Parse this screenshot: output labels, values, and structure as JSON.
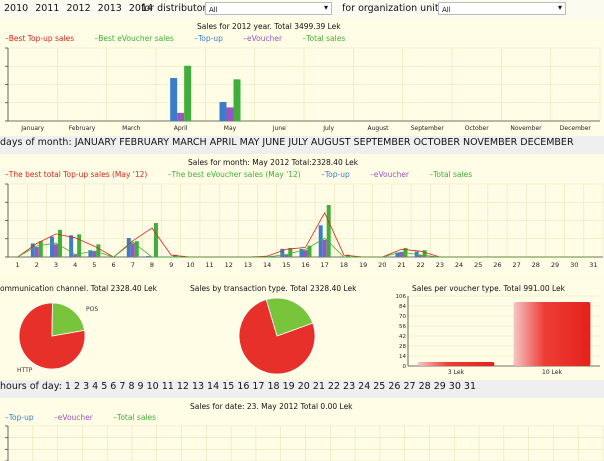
{
  "filters": {
    "years": [
      "2010",
      "2011",
      "2012",
      "2013",
      "2014"
    ],
    "distributor_label": "for distributor:",
    "distributor_value": "All",
    "org_label": "for organization unit:",
    "org_value": "All"
  },
  "year_chart": {
    "title": "Sales for 2012 year. Total 3499.39 Lek",
    "legend": [
      {
        "label": "Best Top-up sales",
        "color": "#d9261c"
      },
      {
        "label": "Best eVoucher sales",
        "color": "#3fae3a"
      },
      {
        "label": "Top-up",
        "color": "#3a7dc9"
      },
      {
        "label": "eVoucher",
        "color": "#9a55c0"
      },
      {
        "label": "Total sales",
        "color": "#3fae3a"
      }
    ]
  },
  "days_strip": {
    "prefix": "days of month:",
    "months": [
      "JANUARY",
      "FEBRUARY",
      "MARCH",
      "APRIL",
      "MAY",
      "JUNE",
      "JULY",
      "AUGUST",
      "SEPTEMBER",
      "OCTOBER",
      "NOVEMBER",
      "DECEMBER"
    ]
  },
  "month_chart": {
    "title": "Sales for month: May 2012 Total:2328.40 Lek",
    "legend": [
      {
        "label": "The best total Top-up sales (May '12)",
        "color": "#d9261c"
      },
      {
        "label": "The best eVoucher sales (May '12)",
        "color": "#3fae3a"
      },
      {
        "label": "Top-up",
        "color": "#3a7dc9"
      },
      {
        "label": "eVoucher",
        "color": "#9a55c0"
      },
      {
        "label": "Total sales",
        "color": "#3fae3a"
      }
    ]
  },
  "pie_channel": {
    "title": "ommunication channel. Total 2328.40 Lek",
    "labels": [
      "POS",
      "HTTP"
    ]
  },
  "pie_transaction": {
    "title": "Sales by transaction type. Total 2328.40 Lek"
  },
  "voucher_chart": {
    "title": "Sales per voucher type. Total 991.00 Lek"
  },
  "hours_strip": {
    "prefix": "hours of day:",
    "days": [
      "1",
      "2",
      "3",
      "4",
      "5",
      "6",
      "7",
      "8",
      "9",
      "10",
      "11",
      "12",
      "13",
      "14",
      "15",
      "16",
      "17",
      "18",
      "19",
      "20",
      "21",
      "22",
      "23",
      "24",
      "25",
      "26",
      "27",
      "28",
      "29",
      "30",
      "31"
    ]
  },
  "date_chart": {
    "title": "Sales for date: 23. May 2012 Total 0.00 Lek",
    "legend": [
      {
        "label": "Top-up",
        "color": "#3a7dc9"
      },
      {
        "label": "eVoucher",
        "color": "#9a55c0"
      },
      {
        "label": "Total sales",
        "color": "#3fae3a"
      }
    ]
  },
  "chart_data": [
    {
      "type": "bar",
      "title": "Sales for 2012 year. Total 3499.39 Lek",
      "categories": [
        "January",
        "February",
        "March",
        "April",
        "May",
        "June",
        "July",
        "August",
        "September",
        "October",
        "November",
        "December"
      ],
      "series": [
        {
          "name": "Top-up",
          "color": "#3a7dc9",
          "values": [
            0,
            0,
            0,
            0.95,
            0.42,
            0,
            0,
            0,
            0,
            0,
            0,
            0
          ]
        },
        {
          "name": "eVoucher",
          "color": "#9a55c0",
          "values": [
            0,
            0,
            0,
            0.18,
            0.3,
            0,
            0,
            0,
            0,
            0,
            0,
            0
          ]
        },
        {
          "name": "Total sales",
          "color": "#3fae3a",
          "values": [
            0,
            0,
            0.01,
            1.22,
            0.92,
            0,
            0,
            0,
            0,
            0,
            0,
            0
          ]
        }
      ]
    },
    {
      "type": "bar",
      "title": "Sales for month: May 2012 Total:2328.40 Lek",
      "categories": [
        "1",
        "2",
        "3",
        "4",
        "5",
        "6",
        "7",
        "8",
        "9",
        "10",
        "11",
        "12",
        "13",
        "14",
        "15",
        "16",
        "17",
        "18",
        "19",
        "20",
        "21",
        "22",
        "23",
        "24",
        "25",
        "26",
        "27",
        "28",
        "29",
        "30",
        "31"
      ],
      "series": [
        {
          "name": "Top-up",
          "color": "#3a7dc9",
          "values": [
            0,
            0.3,
            0.45,
            0.48,
            0.15,
            0,
            0.42,
            0.02,
            0,
            0,
            0,
            0,
            0,
            0,
            0.18,
            0.18,
            0.7,
            0,
            0,
            0,
            0.1,
            0.12,
            0,
            0,
            0,
            0,
            0,
            0,
            0,
            0,
            0
          ]
        },
        {
          "name": "eVoucher",
          "color": "#9a55c0",
          "values": [
            0,
            0.22,
            0.28,
            0.05,
            0.12,
            0,
            0.3,
            0,
            0,
            0,
            0,
            0,
            0,
            0,
            0.05,
            0.15,
            0.38,
            0,
            0,
            0,
            0.1,
            0.04,
            0,
            0,
            0,
            0,
            0,
            0,
            0,
            0,
            0
          ]
        },
        {
          "name": "Total sales",
          "color": "#3fae3a",
          "values": [
            0,
            0.35,
            0.6,
            0.5,
            0.28,
            0,
            0.35,
            0.75,
            0.05,
            0,
            0,
            0,
            0,
            0.02,
            0.2,
            0.25,
            1.15,
            0.05,
            0,
            0,
            0.2,
            0.15,
            0,
            0,
            0,
            0,
            0,
            0,
            0,
            0,
            0
          ]
        }
      ]
    },
    {
      "type": "pie",
      "title": "ommunication channel. Total 2328.40 Lek",
      "slices": [
        {
          "label": "HTTP",
          "value": 0.78,
          "color": "#e8302a"
        },
        {
          "label": "POS",
          "value": 0.22,
          "color": "#78c43a"
        }
      ]
    },
    {
      "type": "pie",
      "title": "Sales by transaction type. Total 2328.40 Lek",
      "slices": [
        {
          "label": "",
          "value": 0.76,
          "color": "#e8302a"
        },
        {
          "label": "",
          "value": 0.24,
          "color": "#78c43a"
        }
      ]
    },
    {
      "type": "bar",
      "title": "Sales per voucher type. Total 991.00 Lek",
      "categories": [
        "3 Lek",
        "10 Lek"
      ],
      "values": [
        6,
        97
      ],
      "ylim": [
        0,
        106
      ],
      "yticks": [
        "0",
        "14",
        "28",
        "42",
        "56",
        "70",
        "84",
        "106"
      ]
    },
    {
      "type": "line",
      "title": "Sales for date: 23. May 2012 Total 0.00 Lek",
      "series": []
    }
  ]
}
